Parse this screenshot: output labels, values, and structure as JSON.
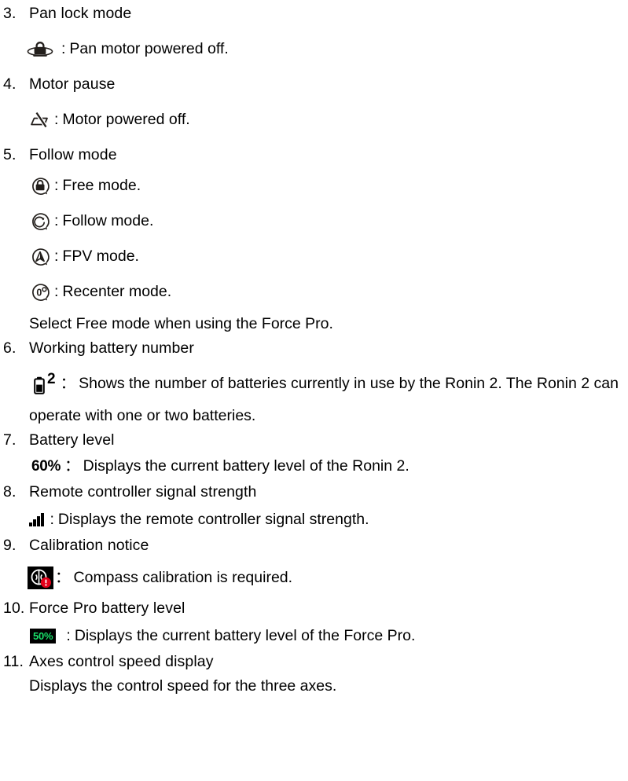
{
  "document": {
    "items": [
      {
        "number": "3.",
        "title": "Pan lock mode",
        "entries": [
          {
            "icon": "pan-lock-icon",
            "separator": ":",
            "text": "Pan motor powered off."
          }
        ]
      },
      {
        "number": "4.",
        "title": "Motor pause",
        "entries": [
          {
            "icon": "motor-off-icon",
            "separator": ":",
            "text": "Motor powered off."
          }
        ]
      },
      {
        "number": "5.",
        "title": "Follow mode",
        "entries": [
          {
            "icon": "free-mode-icon",
            "separator": ":",
            "text": "Free mode."
          },
          {
            "icon": "follow-mode-icon",
            "separator": ":",
            "text": "Follow mode."
          },
          {
            "icon": "fpv-mode-icon",
            "separator": ":",
            "text": "FPV mode."
          },
          {
            "icon": "recenter-mode-icon",
            "separator": ":",
            "text": "Recenter mode."
          }
        ],
        "note": "Select Free mode when using the Force Pro."
      },
      {
        "number": "6.",
        "title": "Working battery number",
        "entries": [
          {
            "icon": "battery-count-icon",
            "icon_label": "2",
            "separator": "：",
            "text": "Shows the number of batteries currently in use by the Ronin 2. The Ronin 2 can"
          }
        ],
        "continuation": "operate with one or two batteries."
      },
      {
        "number": "7.",
        "title": "Battery level",
        "entries": [
          {
            "icon": "battery-percent-text",
            "icon_label": "60%",
            "separator": "：",
            "text": "Displays the current battery level of the Ronin 2."
          }
        ]
      },
      {
        "number": "8.",
        "title": "Remote controller signal strength",
        "entries": [
          {
            "icon": "signal-strength-icon",
            "separator": ":",
            "text": "Displays the remote controller signal strength."
          }
        ]
      },
      {
        "number": "9.",
        "title": "Calibration notice",
        "entries": [
          {
            "icon": "compass-calibration-icon",
            "separator": "：",
            "text": "Compass calibration is required."
          }
        ]
      },
      {
        "number": "10.",
        "title": "Force Pro battery level",
        "entries": [
          {
            "icon": "force-pro-battery-badge",
            "icon_label": "50%",
            "separator": ":",
            "text": "Displays the current battery level of the Force Pro."
          }
        ]
      },
      {
        "number": "11.",
        "title": "Axes control speed display",
        "note": "Displays the control speed for the three axes."
      }
    ]
  },
  "colors": {
    "ink": "#231f1c",
    "text": "#000000",
    "page": "#ffffff",
    "badge_background": "#000000",
    "badge_text": "#19e06a",
    "warning_red": "#e2001a"
  }
}
